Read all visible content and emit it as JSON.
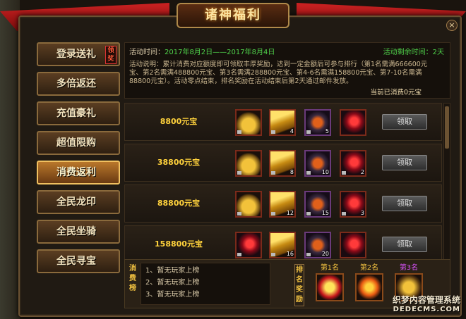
{
  "window": {
    "title": "诸神福利",
    "close_label": "×"
  },
  "sidebar": {
    "items": [
      {
        "label": "登录送礼",
        "tag": "领奖"
      },
      {
        "label": "多倍返还"
      },
      {
        "label": "充值豪礼"
      },
      {
        "label": "超值限购"
      },
      {
        "label": "消费返利",
        "active": true
      },
      {
        "label": "全民龙印"
      },
      {
        "label": "全民坐骑"
      },
      {
        "label": "全民寻宝"
      }
    ]
  },
  "info": {
    "time_label": "活动时间：",
    "time_value": "2017年8月2日——2017年8月4日",
    "remain": "活动剩余时间：2天",
    "desc": "活动说明：累计消费对应额度即可领取丰厚奖励，达到一定金额后可参与排行（第1名需满666600元宝、第2名需满488800元宝、第3名需满288800元宝、第4-6名需满158800元宝、第7-10名需满88800元宝）。活动零点结束，排名奖励在活动结束后第2天通过邮件发放。",
    "rank_text": "当前已消费0元宝"
  },
  "rows": [
    {
      "amount": "8800元宝",
      "counts": [
        "",
        "4",
        "5",
        ""
      ],
      "claim": "领取"
    },
    {
      "amount": "38800元宝",
      "counts": [
        "",
        "8",
        "10",
        "2"
      ],
      "claim": "领取"
    },
    {
      "amount": "88800元宝",
      "counts": [
        "",
        "12",
        "15",
        "3"
      ],
      "claim": "领取"
    },
    {
      "amount": "158800元宝",
      "counts": [
        "",
        "16",
        "20",
        ""
      ],
      "claim": "领取"
    }
  ],
  "consume_rank": {
    "label": "消费榜",
    "entries": [
      "1、暂无玩家上榜",
      "2、暂无玩家上榜",
      "3、暂无玩家上榜"
    ]
  },
  "rank_rewards": {
    "label": "排名奖励",
    "prizes": [
      {
        "label": "第1名"
      },
      {
        "label": "第2名"
      },
      {
        "label": "第3名"
      }
    ]
  },
  "watermark": {
    "cn": "织梦内容管理系统",
    "en": "DEDECMS.COM"
  }
}
